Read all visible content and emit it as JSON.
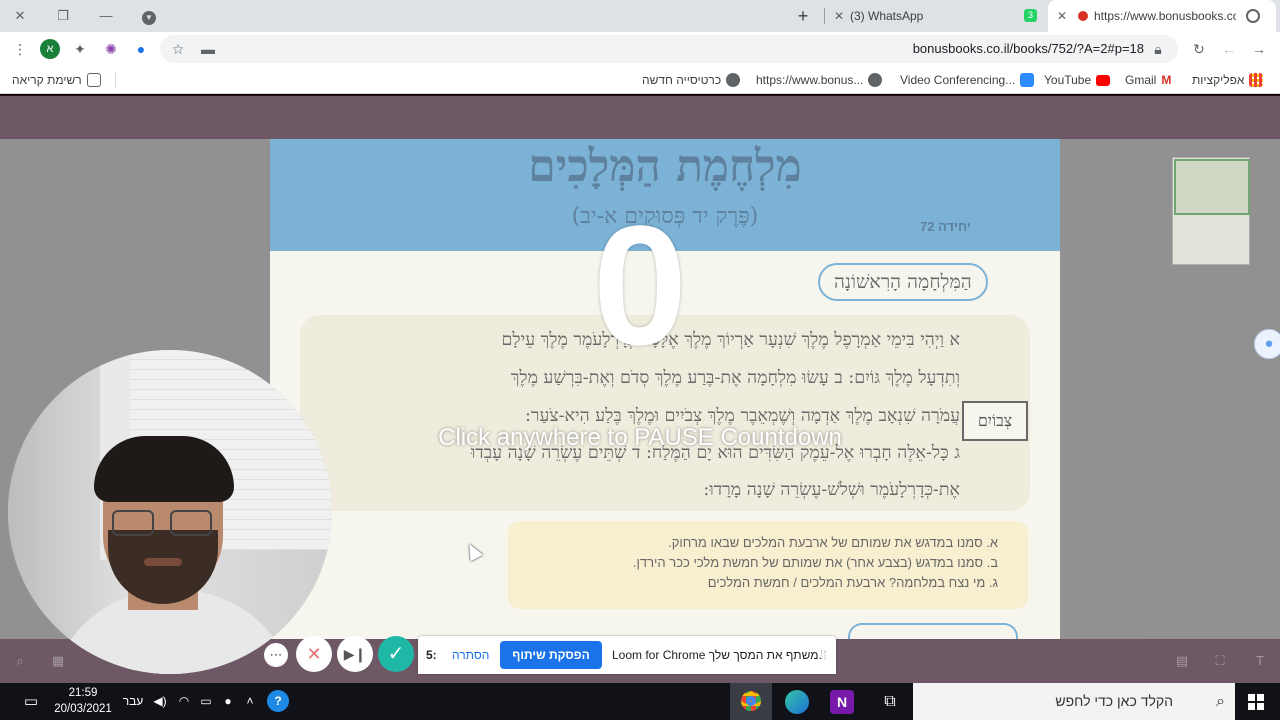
{
  "browser": {
    "tabs": [
      {
        "label": "https://www.bonusbooks.co.il",
        "active": true
      },
      {
        "label": "(3) WhatsApp",
        "active": false,
        "badge": "3"
      }
    ],
    "url": "bonusbooks.co.il/books/752/?A=2#p=18",
    "profile_initial": "א",
    "bookmarks": [
      {
        "label": "אפליקציות",
        "icon": "apps-grid-icon"
      },
      {
        "label": "Gmail",
        "icon": "gmail-icon"
      },
      {
        "label": "YouTube",
        "icon": "youtube-icon"
      },
      {
        "label": "Video Conferencing...",
        "icon": "zoom-icon"
      },
      {
        "label": "https://www.bonus...",
        "icon": "globe-icon"
      },
      {
        "label": "כרטיסייה חדשה",
        "icon": "globe-icon"
      }
    ],
    "reading_list": "רשימת קריאה"
  },
  "book": {
    "title": "מִלְחֶמֶת הַמְּלָכִים",
    "subtitle": "(פֶּרֶק יד פְּסוּקִים א-יב)",
    "unit": "יחידה 72",
    "section": "הַמִּלְחָמָה הָרִאשׁוֹנָה",
    "side_word": "צְבוֹיִם",
    "verses": [
      "א וַיְהִי בִּימֵי אַמְרָפֶל מֶלֶךְ שִׁנְעָר אַרְיוֹךְ מֶלֶךְ אֶלָּסָר כְּדָרְלָעֹמֶר מֶלֶךְ עֵילָם",
      "וְתִדְעָל מֶלֶךְ גּוֹיִם: ב עָשׂוּ מִלְחָמָה אֶת-בֶּרַע מֶלֶךְ סְדֹם וְאֶת-בִּרְשַׁע מֶלֶךְ",
      "עֲמֹרָה שִׁנְאָב מֶלֶךְ אַדְמָה וְשֶׁמְאֵבֶר מֶלֶךְ צְבֹיִים וּמֶלֶךְ בֶּלַע הִיא-צֹעַר:",
      "ג כָּל-אֵלֶּה חָבְרוּ אֶל-עֵמֶק הַשִּׂדִּים הוּא יָם הַמֶּלַח: ד שְׁתֵּים עֶשְׂרֵה שָׁנָה עָבְדוּ",
      "אֶת-כְּדָרְלָעֹמֶר וּשְׁלֹשׁ-עֶשְׂרֵה שָׁנָה מָרָדוּ:"
    ],
    "questions": [
      "א. סמנו במדגש את שמותם של ארבעת המלכים שבאו מרחוק.",
      "ב. סמנו במדגש (בצבע אחר) את שמותם של חמשת מלכי ככר הירדן.",
      "ג. מי נצח במלחמה? ארבעת המלכים / חמשת המלכים"
    ]
  },
  "countdown": {
    "digit": "0",
    "message": "Click anywhere to PAUSE Countdown"
  },
  "loom": {
    "timer": "5:",
    "hide_label": "הסתרה",
    "stop_label": "הפסקת שיתוף",
    "message": "Loom for Chrome משתף את המסך שלך.",
    "controls": [
      "more-options",
      "cancel",
      "pause",
      "finish"
    ]
  },
  "taskbar": {
    "time": "21:59",
    "date": "20/03/2021",
    "language": "עבר",
    "search_placeholder": "הקלד כאן כדי לחפש"
  },
  "colors": {
    "page_bar": "#2a0a1e",
    "book_header": "#3d8ec3",
    "loom_check": "#1fb7a5",
    "loom_stop": "#1a73e8"
  }
}
